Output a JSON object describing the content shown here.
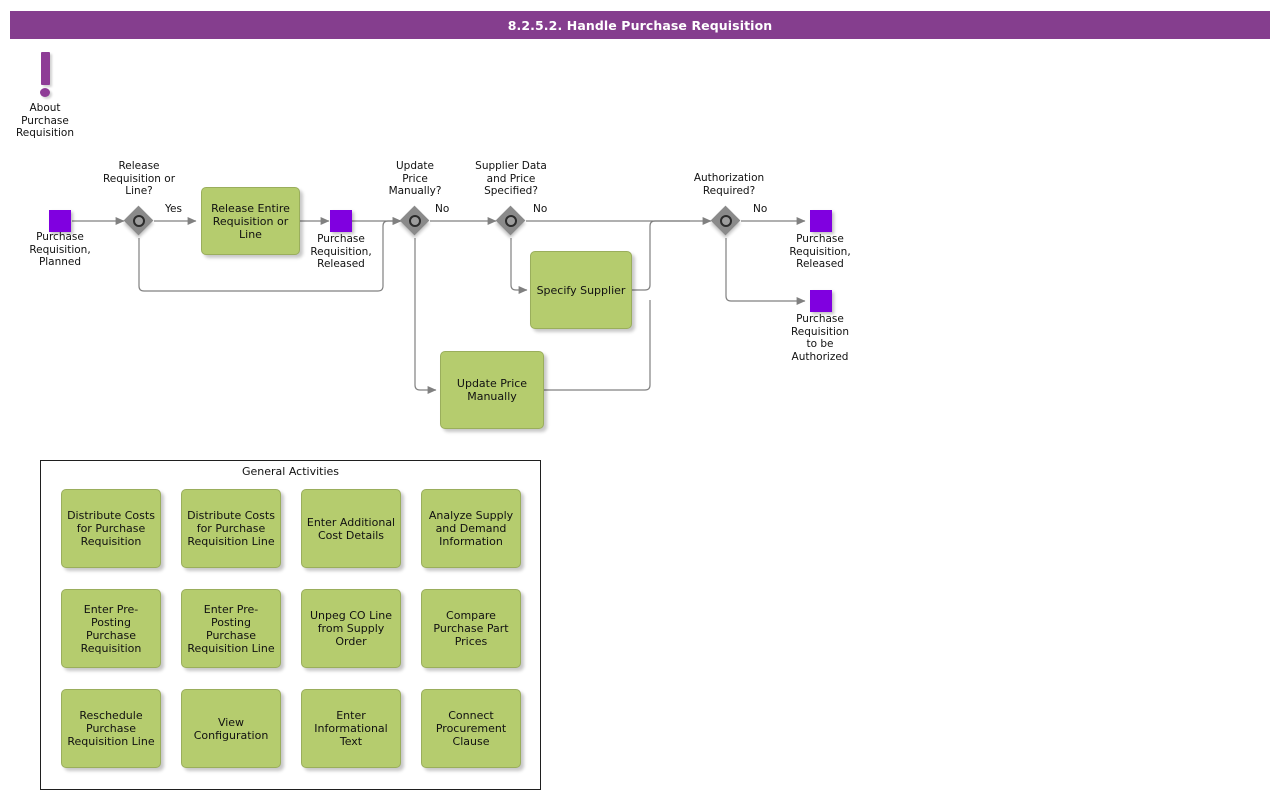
{
  "header": {
    "title": "8.2.5.2. Handle Purchase Requisition",
    "bar_color": "#853e8e",
    "text_color": "#ffffff"
  },
  "palette": {
    "activity_fill": "#b5cc6e",
    "activity_border": "#9aae5c",
    "state_fill": "#8000e0",
    "gateway_fill": "#8a8a8a",
    "connector": "#808080",
    "note_marker": "#8e3c96"
  },
  "note": {
    "icon": "exclamation-mark-icon",
    "label": "About\nPurchase\nRequisition"
  },
  "states": [
    {
      "id": "pr-planned",
      "label": "Purchase\nRequisition,\nPlanned"
    },
    {
      "id": "pr-released-1",
      "label": "Purchase\nRequisition,\nReleased"
    },
    {
      "id": "pr-released-2",
      "label": "Purchase\nRequisition,\nReleased"
    },
    {
      "id": "pr-to-authorize",
      "label": "Purchase\nRequisition\nto be\nAuthorized"
    }
  ],
  "gateways": [
    {
      "id": "gw-release",
      "label": "Release\nRequisition or\nLine?"
    },
    {
      "id": "gw-update-price",
      "label": "Update\nPrice\nManually?"
    },
    {
      "id": "gw-supplier",
      "label": "Supplier Data\nand Price\nSpecified?"
    },
    {
      "id": "gw-authorization",
      "label": "Authorization\nRequired?"
    }
  ],
  "flow_labels": [
    {
      "id": "lbl-yes-release",
      "text": "Yes"
    },
    {
      "id": "lbl-no-price",
      "text": "No"
    },
    {
      "id": "lbl-no-supplier",
      "text": "No"
    },
    {
      "id": "lbl-no-authorization",
      "text": "No"
    }
  ],
  "activities": [
    {
      "id": "act-release-entire",
      "label": "Release Entire\nRequisition or\nLine"
    },
    {
      "id": "act-specify-supplier",
      "label": "Specify Supplier"
    },
    {
      "id": "act-update-price",
      "label": "Update Price\nManually"
    }
  ],
  "general_activities": {
    "title": "General Activities",
    "items": [
      {
        "id": "ga-distribute-costs-pr",
        "label": "Distribute Costs\nfor Purchase\nRequisition"
      },
      {
        "id": "ga-distribute-costs-pr-line",
        "label": "Distribute Costs\nfor Purchase\nRequisition Line"
      },
      {
        "id": "ga-enter-additional-cost",
        "label": "Enter Additional\nCost Details"
      },
      {
        "id": "ga-analyze-supply-demand",
        "label": "Analyze Supply\nand Demand\nInformation"
      },
      {
        "id": "ga-enter-preposting-pr",
        "label": "Enter Pre-\nPosting\nPurchase\nRequisition"
      },
      {
        "id": "ga-enter-preposting-pr-line",
        "label": "Enter Pre-\nPosting\nPurchase\nRequisition Line"
      },
      {
        "id": "ga-unpeg-co-line",
        "label": "Unpeg CO Line\nfrom Supply\nOrder"
      },
      {
        "id": "ga-compare-part-prices",
        "label": "Compare\nPurchase Part\nPrices"
      },
      {
        "id": "ga-reschedule-pr-line",
        "label": "Reschedule\nPurchase\nRequisition Line"
      },
      {
        "id": "ga-view-configuration",
        "label": "View\nConfiguration"
      },
      {
        "id": "ga-enter-informational-text",
        "label": "Enter\nInformational\nText"
      },
      {
        "id": "ga-connect-procurement",
        "label": "Connect\nProcurement\nClause"
      }
    ]
  }
}
